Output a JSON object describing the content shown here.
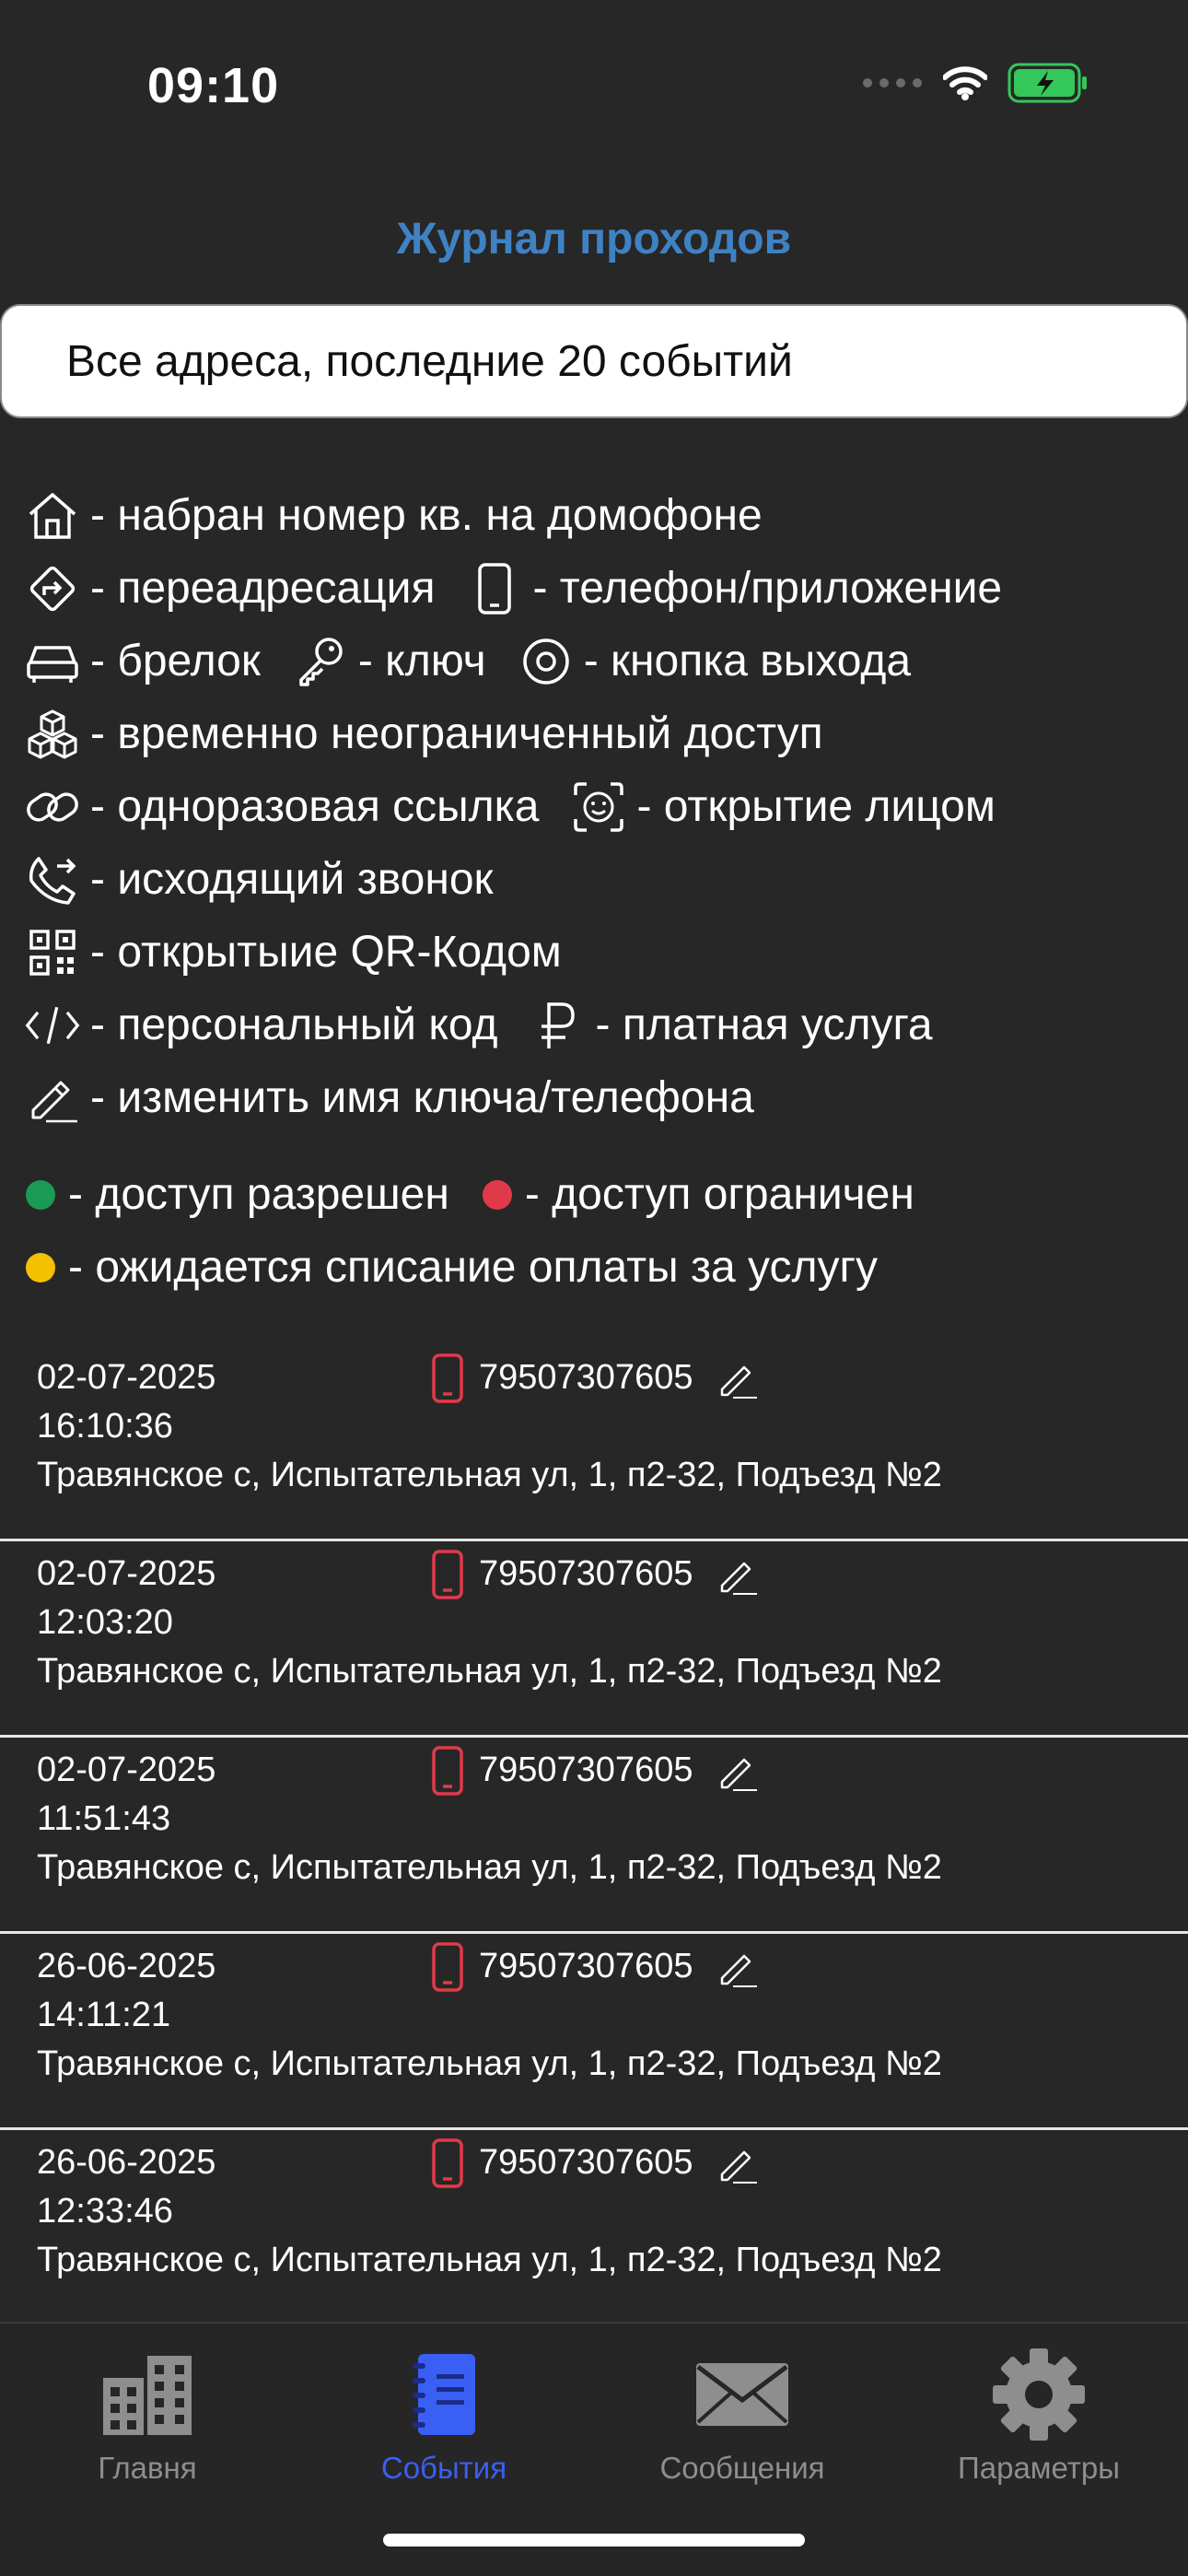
{
  "status_bar": {
    "time": "09:10"
  },
  "header": {
    "title": "Журнал проходов"
  },
  "filter": {
    "label": "Все адреса, последние 20 событий"
  },
  "legend": {
    "home": "- набран номер кв. на домофоне",
    "redirect": "- переадресация",
    "phone": "- телефон/приложение",
    "fob": "- брелок",
    "key": "- ключ",
    "exit_button": "- кнопка выхода",
    "unlimited": "- временно неограниченный доступ",
    "link": "- одноразовая ссылка",
    "face": "- открытие лицом",
    "outgoing_call": "- исходящий звонок",
    "qr": "- открытыие QR-Кодом",
    "personal_code": "- персональный код",
    "paid": "- платная услуга",
    "rename": "- изменить имя ключа/телефона",
    "allowed": "- доступ разрешен",
    "restricted": "- доступ ограничен",
    "pending": "- ожидается списание оплаты за услугу"
  },
  "colors": {
    "allowed": "#1a9a55",
    "restricted": "#e03a4a",
    "pending": "#f5c000",
    "accent": "#3f82c4",
    "active_tab": "#3a5ff5"
  },
  "events": [
    {
      "date": "02-07-2025",
      "time": "16:10:36",
      "number": "79507307605",
      "address": "Травянское с, Испытательная ул, 1, п2-32, Подъезд №2"
    },
    {
      "date": "02-07-2025",
      "time": "12:03:20",
      "number": "79507307605",
      "address": "Травянское с, Испытательная ул, 1, п2-32, Подъезд №2"
    },
    {
      "date": "02-07-2025",
      "time": "11:51:43",
      "number": "79507307605",
      "address": "Травянское с, Испытательная ул, 1, п2-32, Подъезд №2"
    },
    {
      "date": "26-06-2025",
      "time": "14:11:21",
      "number": "79507307605",
      "address": "Травянское с, Испытательная ул, 1, п2-32, Подъезд №2"
    },
    {
      "date": "26-06-2025",
      "time": "12:33:46",
      "number": "79507307605",
      "address": "Травянское с, Испытательная ул, 1, п2-32, Подъезд №2"
    }
  ],
  "tabs": [
    {
      "label": "Главня",
      "icon": "buildings-icon"
    },
    {
      "label": "События",
      "icon": "notebook-icon"
    },
    {
      "label": "Сообщения",
      "icon": "envelope-icon"
    },
    {
      "label": "Параметры",
      "icon": "gear-icon"
    }
  ]
}
